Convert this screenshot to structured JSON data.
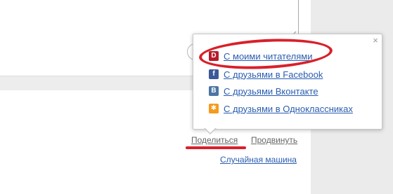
{
  "share_popup": {
    "close_glyph": "×",
    "items": [
      {
        "icon": "d-icon",
        "icon_glyph": "D",
        "label": "С моими читателями",
        "color": "#b71a2a"
      },
      {
        "icon": "facebook-icon",
        "icon_glyph": "f",
        "label": "С друзьями в Facebook",
        "color": "#3b5998"
      },
      {
        "icon": "vkontakte-icon",
        "icon_glyph": "В",
        "label": "С друзьями Вконтакте",
        "color": "#4c75a3"
      },
      {
        "icon": "odnoklassniki-icon",
        "icon_glyph": "✱",
        "label": "С друзьями в Одноклассниках",
        "color": "#f59a1c"
      }
    ]
  },
  "actions": {
    "share_label": "Поделиться",
    "promote_label": "Продвинуть",
    "random_machine_label": "Случайная машина"
  },
  "colors": {
    "link": "#2a5db0",
    "highlight": "#d8202a"
  }
}
